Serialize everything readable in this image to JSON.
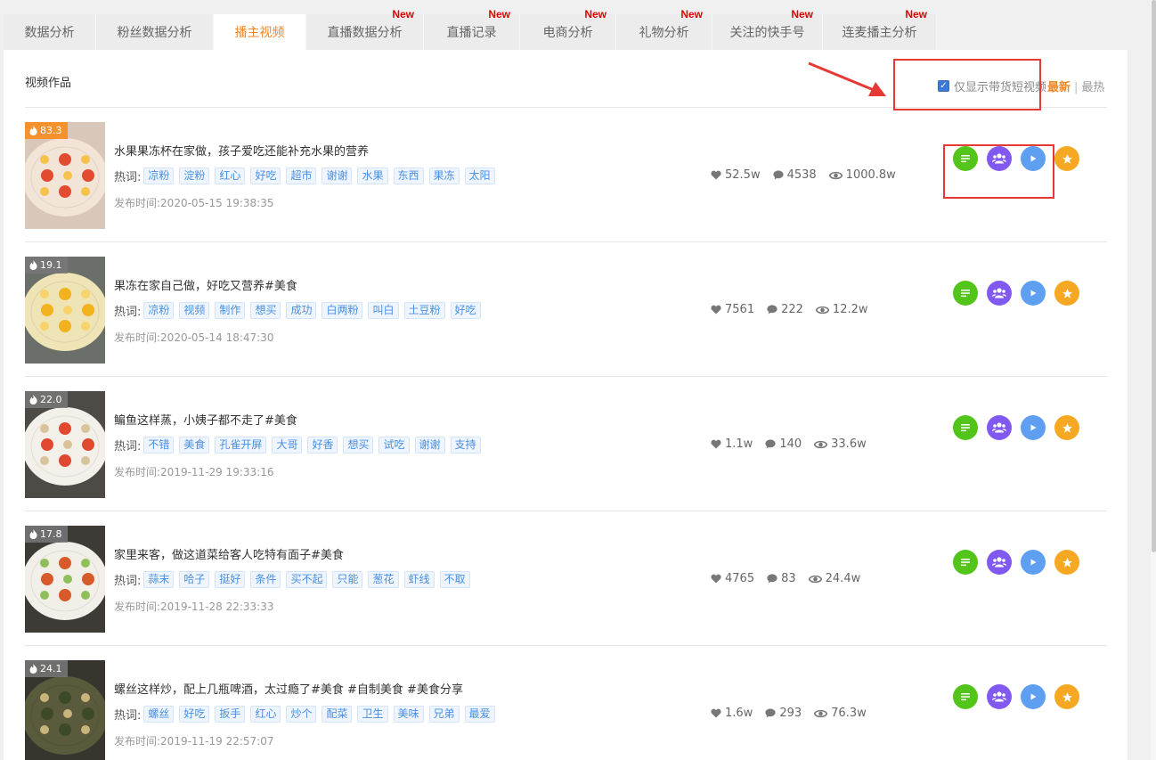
{
  "tabs": [
    {
      "label": "数据分析",
      "new": ""
    },
    {
      "label": "粉丝数据分析",
      "new": ""
    },
    {
      "label": "播主视频",
      "new": "",
      "active": true
    },
    {
      "label": "直播数据分析",
      "new": "New"
    },
    {
      "label": "直播记录",
      "new": "New"
    },
    {
      "label": "电商分析",
      "new": "New"
    },
    {
      "label": "礼物分析",
      "new": "New"
    },
    {
      "label": "关注的快手号",
      "new": "New"
    },
    {
      "label": "连麦播主分析",
      "new": "New"
    }
  ],
  "panel": {
    "title": "视频作品",
    "filter_checkbox_label": "仅显示带货短视频",
    "filter_checked": true,
    "sort_latest": "最新",
    "sort_separator": "|",
    "sort_hottest": "最热"
  },
  "labels": {
    "keywords": "热词:",
    "published": "发布时间:"
  },
  "videos": [
    {
      "heat": "83.3",
      "hot": true,
      "title": "水果果冻杯在家做，孩子爱吃还能补充水果的营养",
      "tags": [
        "凉粉",
        "淀粉",
        "红心",
        "好吃",
        "超市",
        "谢谢",
        "水果",
        "东西",
        "果冻",
        "太阳"
      ],
      "time": "2020-05-15 19:38:35",
      "likes": "52.5w",
      "comments": "4538",
      "views": "1000.8w"
    },
    {
      "heat": "19.1",
      "hot": false,
      "title": "果冻在家自己做，好吃又营养#美食",
      "tags": [
        "凉粉",
        "视频",
        "制作",
        "想买",
        "成功",
        "白两粉",
        "叫白",
        "土豆粉",
        "好吃"
      ],
      "time": "2020-05-14 18:47:30",
      "likes": "7561",
      "comments": "222",
      "views": "12.2w"
    },
    {
      "heat": "22.0",
      "hot": false,
      "title": "鳊鱼这样蒸，小姨子都不走了#美食",
      "tags": [
        "不错",
        "美食",
        "孔雀开屏",
        "大哥",
        "好香",
        "想买",
        "试吃",
        "谢谢",
        "支持"
      ],
      "time": "2019-11-29 19:33:16",
      "likes": "1.1w",
      "comments": "140",
      "views": "33.6w"
    },
    {
      "heat": "17.8",
      "hot": false,
      "title": "家里来客，做这道菜给客人吃特有面子#美食",
      "tags": [
        "蒜末",
        "哈子",
        "挺好",
        "条件",
        "买不起",
        "只能",
        "葱花",
        "虾线",
        "不取"
      ],
      "time": "2019-11-28 22:33:33",
      "likes": "4765",
      "comments": "83",
      "views": "24.4w"
    },
    {
      "heat": "24.1",
      "hot": false,
      "title": "螺丝这样炒，配上几瓶啤酒，太过瘾了#美食 #自制美食 #美食分享",
      "tags": [
        "螺丝",
        "好吃",
        "扳手",
        "红心",
        "炒个",
        "配菜",
        "卫生",
        "美味",
        "兄弟",
        "最爱"
      ],
      "time": "2019-11-19 22:57:07",
      "likes": "1.6w",
      "comments": "293",
      "views": "76.3w"
    }
  ],
  "colors": {
    "accent": "#f0872a",
    "new_badge": "#e60000",
    "tag_text": "#4a8fe0",
    "detail_button": "#52c41a",
    "fans_button": "#8159f0",
    "play_button": "#5f9ff2",
    "favorite_button": "#f6a823",
    "annotation": "#e53935"
  },
  "icons": {
    "heat": "flame-icon",
    "likes": "heart-icon",
    "comments": "comment-icon",
    "views": "eye-icon",
    "detail": "list-icon",
    "fans": "users-icon",
    "play": "play-icon",
    "favorite": "star-icon"
  }
}
